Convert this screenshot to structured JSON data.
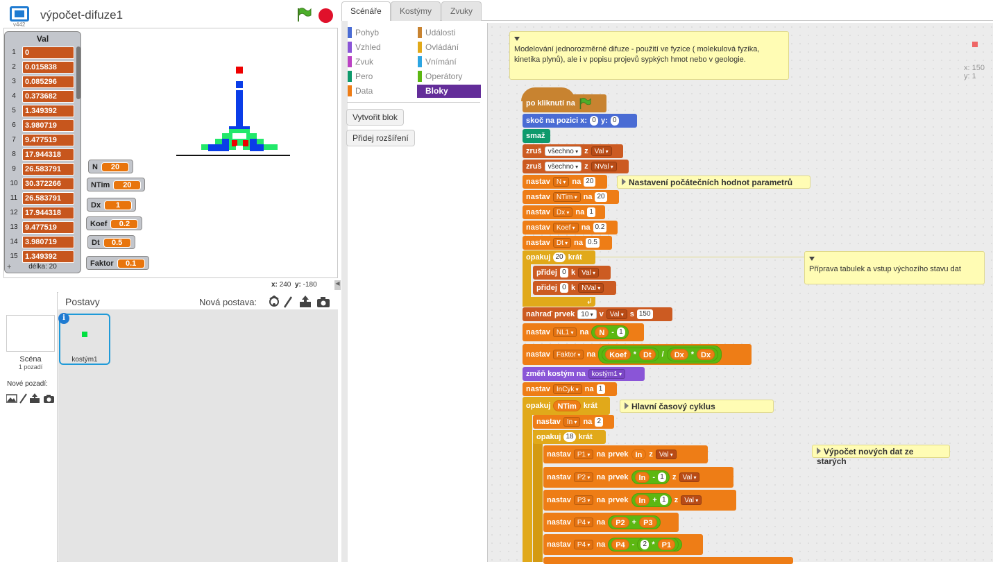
{
  "stage": {
    "version": "v442",
    "project_title": "výpočet-difuze1",
    "coords": {
      "x_label": "x:",
      "x": "240",
      "y_label": "y:",
      "y": "-180"
    }
  },
  "list_monitor": {
    "title": "Val",
    "items": [
      {
        "index": "1",
        "value": "0"
      },
      {
        "index": "2",
        "value": "0.015838"
      },
      {
        "index": "3",
        "value": "0.085296"
      },
      {
        "index": "4",
        "value": "0.373682"
      },
      {
        "index": "5",
        "value": "1.349392"
      },
      {
        "index": "6",
        "value": "3.980719"
      },
      {
        "index": "7",
        "value": "9.477519"
      },
      {
        "index": "8",
        "value": "17.944318"
      },
      {
        "index": "9",
        "value": "26.583791"
      },
      {
        "index": "10",
        "value": "30.372266"
      },
      {
        "index": "11",
        "value": "26.583791"
      },
      {
        "index": "12",
        "value": "17.944318"
      },
      {
        "index": "13",
        "value": "9.477519"
      },
      {
        "index": "14",
        "value": "3.980719"
      },
      {
        "index": "15",
        "value": "1.349392"
      }
    ],
    "footer_plus": "+",
    "length_label": "délka: 20"
  },
  "variable_monitors": [
    {
      "name": "N",
      "value": "20"
    },
    {
      "name": "NTim",
      "value": "20"
    },
    {
      "name": "Dx",
      "value": "1"
    },
    {
      "name": "Koef",
      "value": "0.2"
    },
    {
      "name": "Dt",
      "value": "0.5"
    },
    {
      "name": "Faktor",
      "value": "0.1"
    }
  ],
  "sprite_pane": {
    "scene_label": "Scéna",
    "scene_count": "1 pozadí",
    "new_background_label": "Nové pozadí:",
    "sprites_label": "Postavy",
    "new_sprite_label": "Nová postava:",
    "info_glyph": "i",
    "sprite_name": "kostým1"
  },
  "tabs": [
    "Scénáře",
    "Kostýmy",
    "Zvuky"
  ],
  "categories": [
    {
      "label": "Pohyb",
      "color": "#4a6cd4"
    },
    {
      "label": "Vzhled",
      "color": "#8a55d7"
    },
    {
      "label": "Zvuk",
      "color": "#bb42c3"
    },
    {
      "label": "Pero",
      "color": "#0e9a6c"
    },
    {
      "label": "Data",
      "color": "#ee7d16"
    },
    {
      "label": "Události",
      "color": "#c88330"
    },
    {
      "label": "Ovládání",
      "color": "#e1a91a"
    },
    {
      "label": "Vnímání",
      "color": "#2ca5e2"
    },
    {
      "label": "Operátory",
      "color": "#5cb712"
    },
    {
      "label": "Bloky",
      "color": "#632d99"
    }
  ],
  "palette_buttons": {
    "make_block": "Vytvořit blok",
    "add_extension": "Přidej rozšíření"
  },
  "scripts": {
    "coord_x": "x: 150",
    "coord_y": "y: 1",
    "notes": {
      "top": "Modelování jednorozměrné difuze - použití ve fyzice ( molekulová fyzika, kinetika plynů), ale i v popisu projevů sypkých hmot nebo v geologie.",
      "init": "Nastavení počátečních hodnot parametrů",
      "prep": "Příprava tabulek a vstup výchozího stavu dat",
      "main": "Hlavní časový cyklus",
      "calc": "Výpočet nových dat ze starých"
    },
    "blocks": {
      "hat": "po kliknutí na",
      "goto": "skoč na pozici x:",
      "goto_x": "0",
      "goto_y_label": "y:",
      "goto_y": "0",
      "clear": "smaž",
      "zrus": "zruš",
      "vse": "všechno",
      "z": "z",
      "val": "Val",
      "nval": "NVal",
      "nastav": "nastav",
      "na": "na",
      "v_n": "N",
      "v_n_val": "20",
      "v_ntim": "NTim",
      "v_ntim_val": "20",
      "v_dx": "Dx",
      "v_dx_val": "1",
      "v_koef": "Koef",
      "v_koef_val": "0.2",
      "v_dt": "Dt",
      "v_dt_val": "0.5",
      "opakuj": "opakuj",
      "krat": "krát",
      "rep1": "20",
      "pridej": "přidej",
      "k": "k",
      "pridej_val": "0",
      "nahrad": "nahraď prvek",
      "nahrad_idx": "10",
      "v": "v",
      "s": "s",
      "nahrad_val": "150",
      "nl1": "NL1",
      "minus": "-",
      "one": "1",
      "faktor": "Faktor",
      "times": "*",
      "div": "/",
      "zmen": "změň kostým na",
      "kostym": "kostým1",
      "incyk": "InCyk",
      "in": "In",
      "two": "2",
      "rep3": "18",
      "p1": "P1",
      "p2": "P2",
      "p3": "P3",
      "p4": "P4",
      "prvek": "prvek",
      "plus": "+"
    }
  }
}
